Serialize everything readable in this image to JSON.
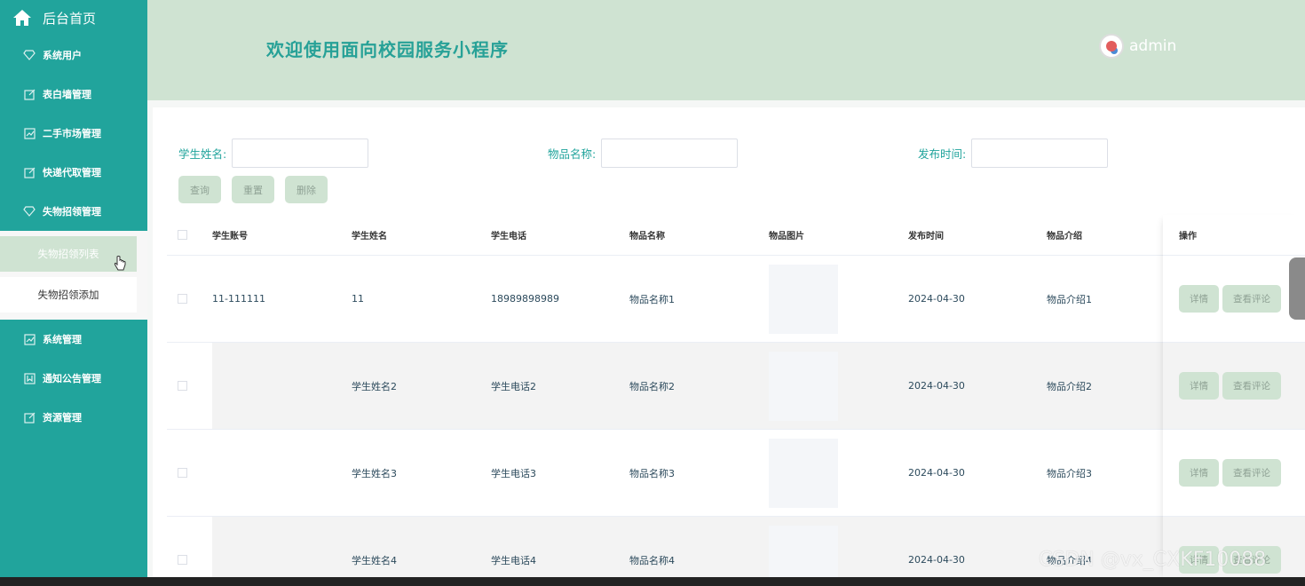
{
  "sidebar": {
    "home_label": "后台首页",
    "menu": [
      {
        "label": "系统用户",
        "icon": "diamond-icon"
      },
      {
        "label": "表白墙管理",
        "icon": "edit-icon"
      },
      {
        "label": "二手市场管理",
        "icon": "chart-icon"
      },
      {
        "label": "快递代取管理",
        "icon": "edit-icon"
      },
      {
        "label": "失物招领管理",
        "icon": "diamond-icon"
      },
      {
        "label": "系统管理",
        "icon": "chart-icon"
      },
      {
        "label": "通知公告管理",
        "icon": "bookmark-icon"
      },
      {
        "label": "资源管理",
        "icon": "edit-icon"
      }
    ],
    "submenu": [
      "失物招领列表",
      "失物招领添加"
    ]
  },
  "header": {
    "title": "欢迎使用面向校园服务小程序",
    "username": "admin"
  },
  "search": {
    "student_name_label": "学生姓名:",
    "item_name_label": "物品名称:",
    "publish_time_label": "发布时间:"
  },
  "buttons": {
    "query": "查询",
    "reset": "重置",
    "delete": "删除"
  },
  "table": {
    "headers": [
      "学生账号",
      "学生姓名",
      "学生电话",
      "物品名称",
      "物品图片",
      "发布时间",
      "物品介绍",
      "操作"
    ],
    "rows": [
      {
        "account": "11-111111",
        "name": "11",
        "phone": "18989898989",
        "item": "物品名称1",
        "time": "2024-04-30",
        "intro": "物品介绍1"
      },
      {
        "account": "",
        "name": "学生姓名2",
        "phone": "学生电话2",
        "item": "物品名称2",
        "time": "2024-04-30",
        "intro": "物品介绍2"
      },
      {
        "account": "",
        "name": "学生姓名3",
        "phone": "学生电话3",
        "item": "物品名称3",
        "time": "2024-04-30",
        "intro": "物品介绍3"
      },
      {
        "account": "",
        "name": "学生姓名4",
        "phone": "学生电话4",
        "item": "物品名称4",
        "time": "2024-04-30",
        "intro": "物品介绍4"
      }
    ],
    "detail_label": "详情",
    "comments_label": "查看评论"
  },
  "watermark": "CSDN @vx_CXKF10088",
  "colors": {
    "sidebar": "#21a49c",
    "header": "#cfe3d2",
    "accent_text": "#27a197",
    "button_bg": "#cfe3d2"
  }
}
